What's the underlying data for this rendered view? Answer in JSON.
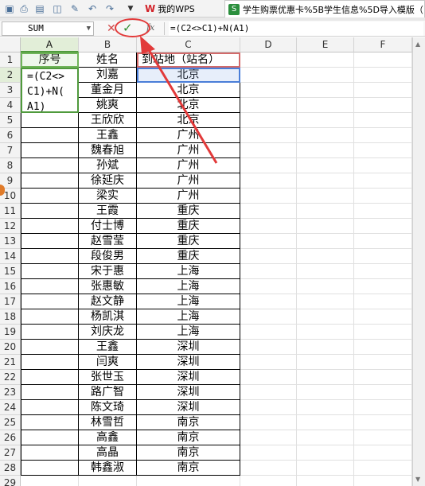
{
  "toolbar": {
    "icons": [
      "save-icon",
      "print-icon",
      "export-pdf-icon",
      "print-preview-icon",
      "format-painter-icon",
      "undo-icon",
      "redo-icon",
      "customize-dropdown-icon"
    ],
    "wps_tab_label": "我的WPS",
    "doc_tab_label": "学生购票优惠卡%5B学生信息%5D导入模版（"
  },
  "formula_bar": {
    "name_box": "SUM",
    "cancel_symbol": "✕",
    "enter_symbol": "✓",
    "fx_label": "fx",
    "formula": "=(C2<>C1)+N(A1)"
  },
  "columns": [
    "A",
    "B",
    "C",
    "D",
    "E",
    "F"
  ],
  "rows": [
    "1",
    "2",
    "3",
    "4",
    "5",
    "6",
    "7",
    "8",
    "9",
    "10",
    "11",
    "12",
    "13",
    "14",
    "15",
    "16",
    "17",
    "18",
    "19",
    "20",
    "21",
    "22",
    "23",
    "24",
    "25",
    "26",
    "27",
    "28",
    "29"
  ],
  "editing_cell_lines": [
    "=(C2<>",
    "C1)+N(",
    "A1)"
  ],
  "headers": {
    "a1": "序号",
    "b1": "姓名",
    "c1": "到站地（站名）"
  },
  "names": [
    "刘嘉",
    "董金月",
    "姚爽",
    "王欣欣",
    "王鑫",
    "魏春旭",
    "孙斌",
    "徐延庆",
    "梁实",
    "王霞",
    "付士博",
    "赵雪莹",
    "段俊男",
    "宋于惠",
    "张惠敏",
    "赵文静",
    "杨凯淇",
    "刘庆龙",
    "王鑫",
    "闫爽",
    "张世玉",
    "路广智",
    "陈文琦",
    "林雪哲",
    "高鑫",
    "高晶",
    "韩鑫淑"
  ],
  "cities": [
    "北京",
    "北京",
    "北京",
    "北京",
    "广州",
    "广州",
    "广州",
    "广州",
    "广州",
    "重庆",
    "重庆",
    "重庆",
    "重庆",
    "上海",
    "上海",
    "上海",
    "上海",
    "上海",
    "深圳",
    "深圳",
    "深圳",
    "深圳",
    "深圳",
    "南京",
    "南京",
    "南京",
    "南京"
  ],
  "colors": {
    "annotation": "#e23a3a",
    "active_header": "#e2eed8",
    "ref_c2": "#4a7ed8",
    "ref_a1": "#70b45a"
  }
}
